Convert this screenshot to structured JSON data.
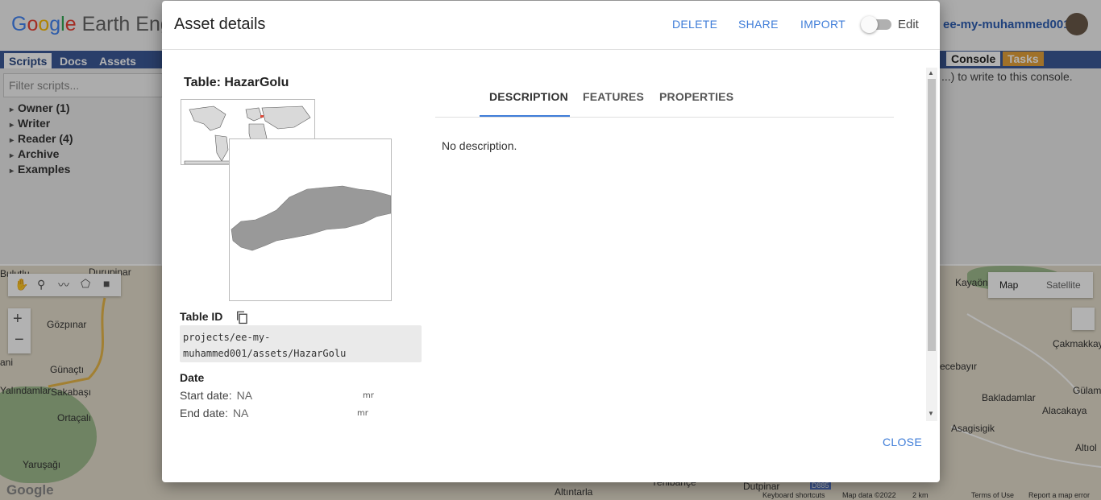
{
  "app": {
    "logo_text": "Google Earth Eng",
    "username": "ee-my-muhammed001",
    "left_tabs": [
      "Scripts",
      "Docs",
      "Assets"
    ],
    "right_tabs": [
      "Console",
      "Tasks"
    ],
    "filter_placeholder": "Filter scripts...",
    "tree": [
      "Owner (1)",
      "Writer",
      "Reader (4)",
      "Archive",
      "Examples"
    ],
    "console_text": "...) to write to this console.",
    "map_types": [
      "Map",
      "Satellite"
    ],
    "map_labels": [
      "Bulutlu",
      "Durupinar",
      "Gözpınar",
      "Günaçtı",
      "Yalındamlar",
      "Sakabaşı",
      "Ortaçalı",
      "Yaruşağı",
      "ani",
      "Kayaön",
      "Çakmakkaya",
      "ecebayır",
      "Bakladamlar",
      "Alacakaya",
      "Gülam",
      "Asagisigik",
      "Altıol",
      "Altıntarla",
      "Dutpinar",
      "Google"
    ],
    "footer": [
      "Keyboard shortcuts",
      "Map data ©2022",
      "2 km",
      "Terms of Use",
      "Report a map error"
    ],
    "road_shield": "D885",
    "yenibahce": "Yenibahçe"
  },
  "dialog": {
    "title": "Asset details",
    "actions": [
      "DELETE",
      "SHARE",
      "IMPORT"
    ],
    "edit_label": "Edit",
    "edit_enabled": false,
    "table_title": "Table: HazarGolu",
    "table_id_label": "Table ID",
    "table_id": "projects/ee-my-muhammed001/assets/HazarGolu",
    "date_label": "Date",
    "start_date_label": "Start date:",
    "start_date_value": "NA",
    "end_date_label": "End date:",
    "end_date_value": "NA",
    "tabs": [
      "DESCRIPTION",
      "FEATURES",
      "PROPERTIES"
    ],
    "active_tab": "DESCRIPTION",
    "description": "No description.",
    "close_label": "CLOSE",
    "utc_icon_label": "mr"
  },
  "colors": {
    "accent": "#3f7dd8",
    "lake_fill": "#999999",
    "tasks_tab": "#e6a23c"
  }
}
